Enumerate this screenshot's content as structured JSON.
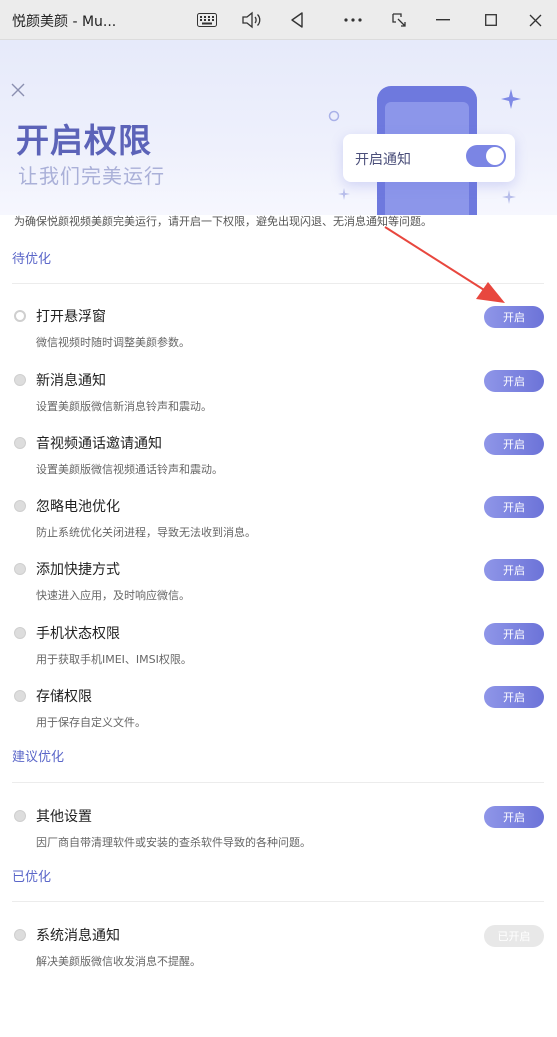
{
  "window": {
    "title": "悦颜美颜 - Mu..."
  },
  "banner": {
    "title": "开启权限",
    "subtitle": "让我们完美运行",
    "toast_label": "开启通知"
  },
  "intro": "为确保悦颜视频美颜完美运行，请开启一下权限，避免出现闪退、无消息通知等问题。",
  "sections": [
    {
      "title": "待优化",
      "items": [
        {
          "name": "打开悬浮窗",
          "desc": "微信视频时随时调整美颜参数。",
          "button": "开启"
        },
        {
          "name": "新消息通知",
          "desc": "设置美颜版微信新消息铃声和震动。",
          "button": "开启"
        },
        {
          "name": "音视频通话邀请通知",
          "desc": "设置美颜版微信视频通话铃声和震动。",
          "button": "开启"
        },
        {
          "name": "忽略电池优化",
          "desc": "防止系统优化关闭进程，导致无法收到消息。",
          "button": "开启"
        },
        {
          "name": "添加快捷方式",
          "desc": "快速进入应用，及时响应微信。",
          "button": "开启"
        },
        {
          "name": "手机状态权限",
          "desc": "用于获取手机IMEI、IMSI权限。",
          "button": "开启"
        },
        {
          "name": "存储权限",
          "desc": "用于保存自定义文件。",
          "button": "开启"
        }
      ]
    },
    {
      "title": "建议优化",
      "items": [
        {
          "name": "其他设置",
          "desc": "因厂商自带清理软件或安装的查杀软件导致的各种问题。",
          "button": "开启"
        }
      ]
    },
    {
      "title": "已优化",
      "items": [
        {
          "name": "系统消息通知",
          "desc": "解决美颜版微信收发消息不提醒。",
          "button": "已开启"
        }
      ]
    }
  ],
  "colors": {
    "accent": "#6c73d8",
    "section_title": "#5b67c9",
    "annotation_arrow": "#e8473e",
    "done_button": "#e8e8e8"
  }
}
